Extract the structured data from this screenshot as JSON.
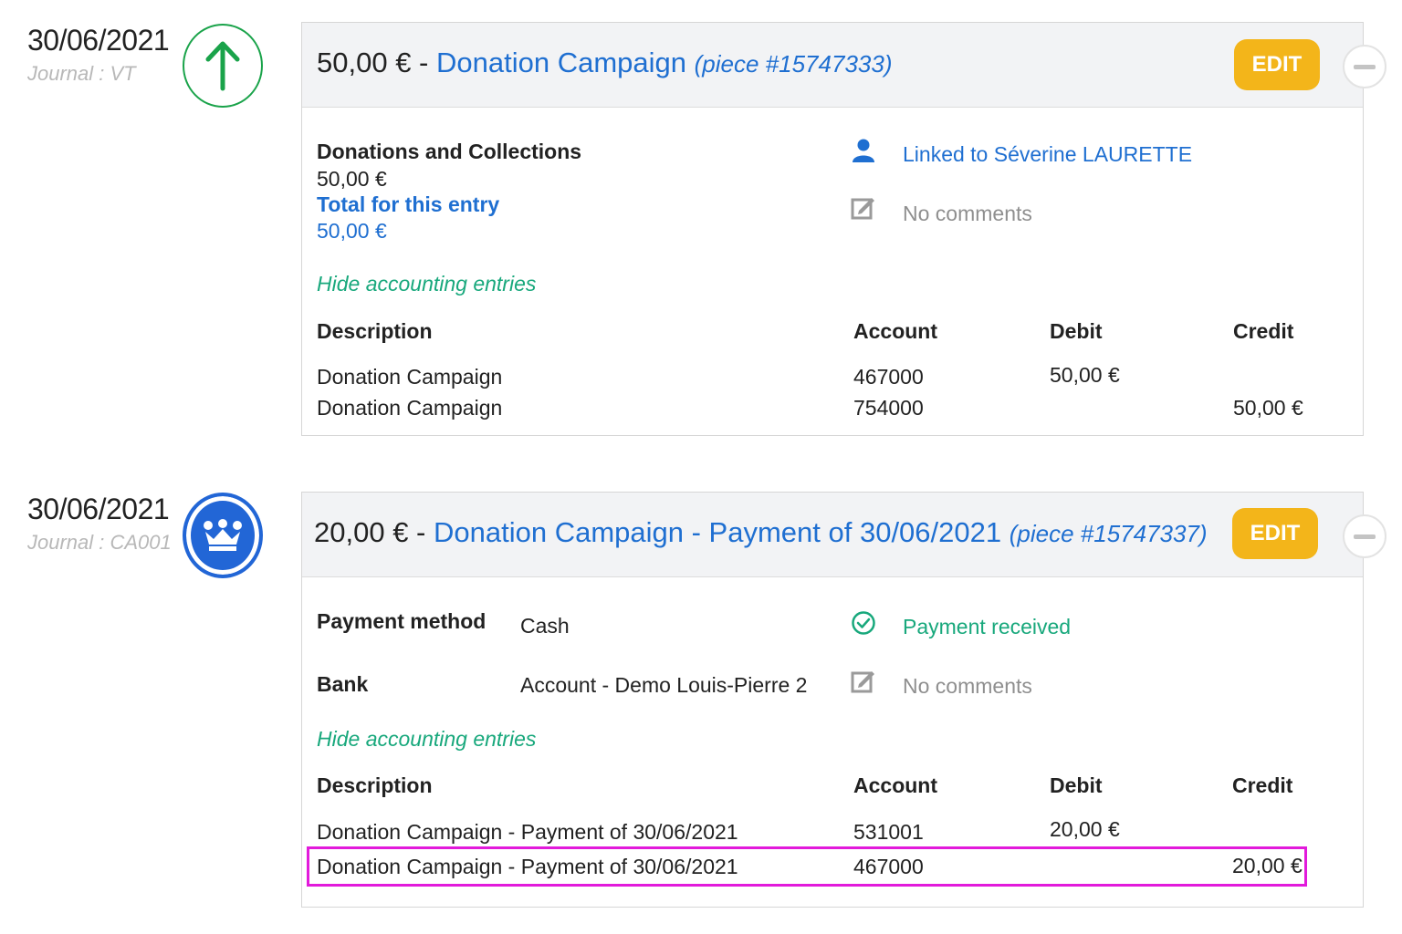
{
  "entries": [
    {
      "date": "30/06/2021",
      "journal": "Journal : VT",
      "icon": "arrow-up-icon",
      "amount": "50,00 €",
      "separator": " - ",
      "title": "Donation Campaign",
      "piece": "(piece #15747333)",
      "edit_label": "EDIT",
      "category": "Donations and Collections",
      "category_amount": "50,00 €",
      "total_label": "Total for this entry",
      "total_amount": "50,00 €",
      "linked_text": "Linked to Séverine LAURETTE",
      "comments": "No comments",
      "hide_label": "Hide accounting entries",
      "columns": [
        "Description",
        "Account",
        "Debit",
        "Credit"
      ],
      "rows": [
        {
          "description": "Donation Campaign",
          "account": "467000",
          "debit": "50,00 €",
          "credit": ""
        },
        {
          "description": "Donation Campaign",
          "account": "754000",
          "debit": "",
          "credit": "50,00 €"
        }
      ]
    },
    {
      "date": "30/06/2021",
      "journal": "Journal : CA001",
      "icon": "crown-icon",
      "amount": "20,00 €",
      "separator": " - ",
      "title": "Donation Campaign - Payment of 30/06/2021",
      "piece": "(piece #15747337)",
      "edit_label": "EDIT",
      "payment_method_label": "Payment method",
      "payment_method_value": "Cash",
      "bank_label": "Bank",
      "bank_value": "Account - Demo Louis-Pierre 2",
      "status": "Payment received",
      "comments": "No comments",
      "hide_label": "Hide accounting entries",
      "columns": [
        "Description",
        "Account",
        "Debit",
        "Credit"
      ],
      "rows": [
        {
          "description": "Donation Campaign - Payment of 30/06/2021",
          "account": "531001",
          "debit": "20,00 €",
          "credit": ""
        },
        {
          "description": "Donation Campaign - Payment of 30/06/2021",
          "account": "467000",
          "debit": "",
          "credit": "20,00 €"
        }
      ]
    }
  ],
  "colors": {
    "accent": "#1f6fd1",
    "edit": "#f3b51a",
    "success": "#18a87c",
    "highlight": "#e21adb"
  }
}
